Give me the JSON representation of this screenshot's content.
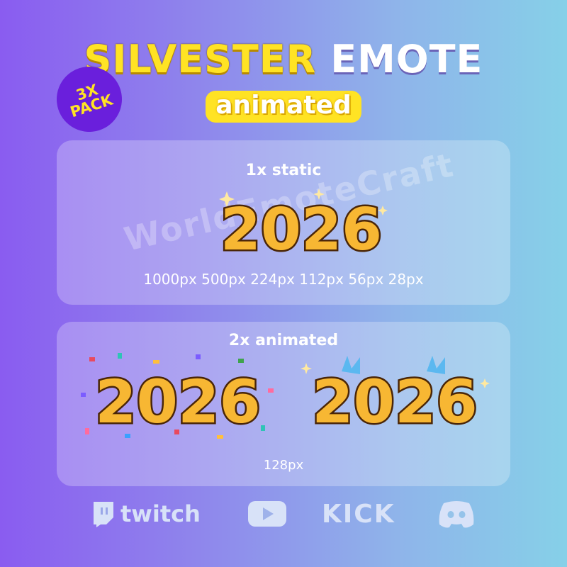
{
  "title": {
    "part1": "SILVESTER",
    "part2": "EMOTE",
    "subtitle": "animated"
  },
  "badge": {
    "line1": "3X",
    "line2": "PACK"
  },
  "static_panel": {
    "label": "1x static",
    "emote_text": "2026",
    "sizes": "1000px 500px 224px 112px 56px 28px"
  },
  "animated_panel": {
    "label": "2x animated",
    "emote_confetti_text": "2026",
    "emote_fireworks_text": "2026",
    "size": "128px"
  },
  "watermark": "WorldEmoteCraft",
  "platforms": {
    "twitch": "twitch",
    "kick": "KICK"
  },
  "colors": {
    "accent_yellow": "#ffe324",
    "badge_purple": "#6a1fdc",
    "digit_gold": "#f7b733"
  }
}
